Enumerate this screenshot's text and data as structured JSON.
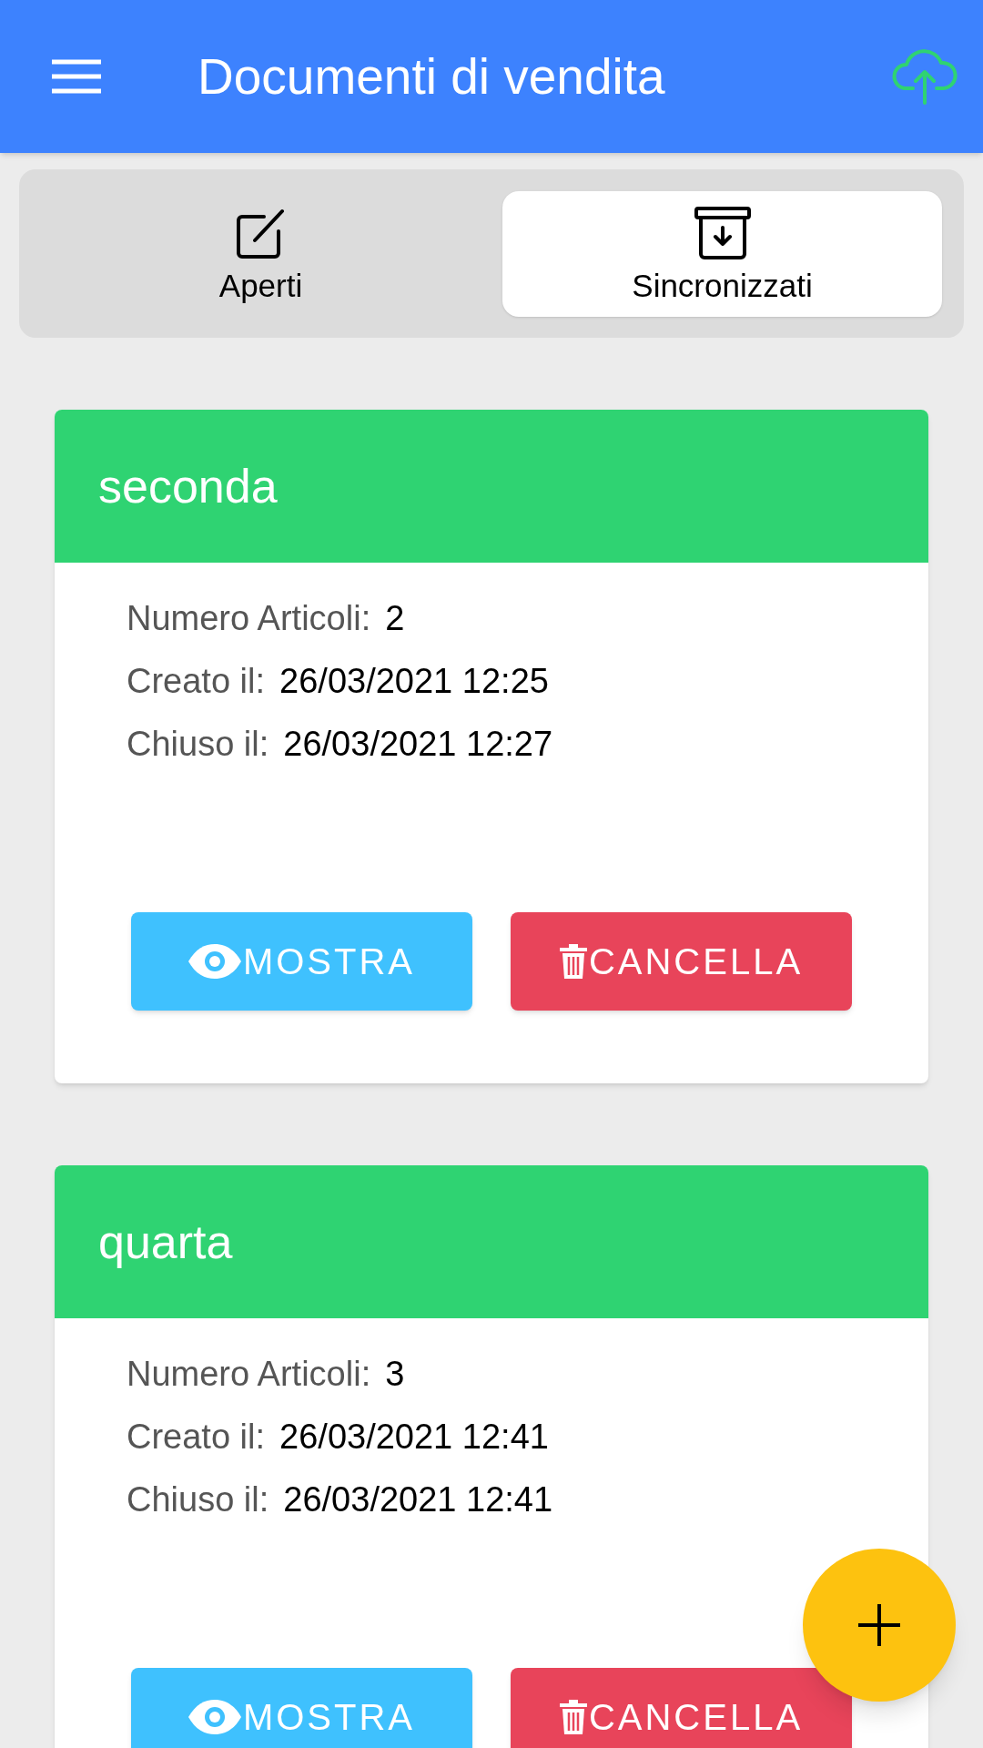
{
  "app_bar": {
    "title": "Documenti di vendita"
  },
  "tabs": [
    {
      "label": "Aperti",
      "kind": "edit",
      "selected": false
    },
    {
      "label": "Sincronizzati",
      "kind": "archive",
      "selected": true
    }
  ],
  "documents": [
    {
      "title": "seconda",
      "fields": [
        {
          "label": "Numero Articoli:",
          "value": "2"
        },
        {
          "label": "Creato il:",
          "value": "26/03/2021 12:25"
        },
        {
          "label": "Chiuso il:",
          "value": "26/03/2021 12:27"
        }
      ],
      "buttons": [
        {
          "label": "MOSTRA",
          "kind": "show"
        },
        {
          "label": "CANCELLA",
          "kind": "delete"
        }
      ]
    },
    {
      "title": "quarta",
      "fields": [
        {
          "label": "Numero Articoli:",
          "value": "3"
        },
        {
          "label": "Creato il:",
          "value": "26/03/2021 12:41"
        },
        {
          "label": "Chiuso il:",
          "value": "26/03/2021 12:41"
        }
      ],
      "buttons": [
        {
          "label": "MOSTRA",
          "kind": "show"
        },
        {
          "label": "CANCELLA",
          "kind": "delete"
        }
      ]
    }
  ]
}
